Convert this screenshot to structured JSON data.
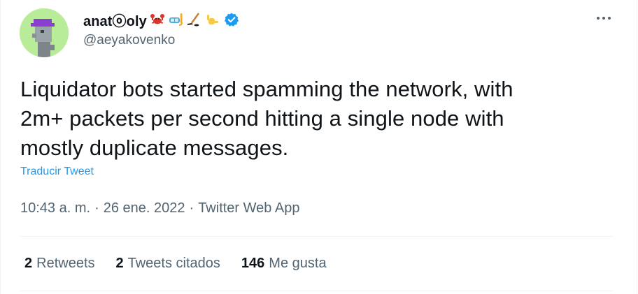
{
  "author": {
    "display_name": "anatⓞoly",
    "handle": "@aeyakovenko",
    "badges": [
      "crab-emoji",
      "diving-mask-emoji",
      "hockey-stick-emoji",
      "call-me-hand-emoji"
    ],
    "verified": true
  },
  "tweet": {
    "text_lines": [
      "Liquidator bots started spamming the network, with",
      "2m+ packets per second hitting a single node with",
      "mostly duplicate messages."
    ],
    "translate_label": "Traducir Tweet"
  },
  "meta": {
    "time": "10:43 a. m.",
    "separator": "·",
    "date": "26 ene. 2022",
    "source": "Twitter Web App"
  },
  "stats": {
    "retweets": {
      "count": "2",
      "label": "Retweets"
    },
    "quotes": {
      "count": "2",
      "label": "Tweets citados"
    },
    "likes": {
      "count": "146",
      "label": "Me gusta"
    }
  },
  "colors": {
    "text": "#0f1419",
    "secondary": "#536471",
    "link": "#1d9bf0",
    "verified": "#1d9bf0",
    "avatar_bg": "#b9ec99"
  }
}
